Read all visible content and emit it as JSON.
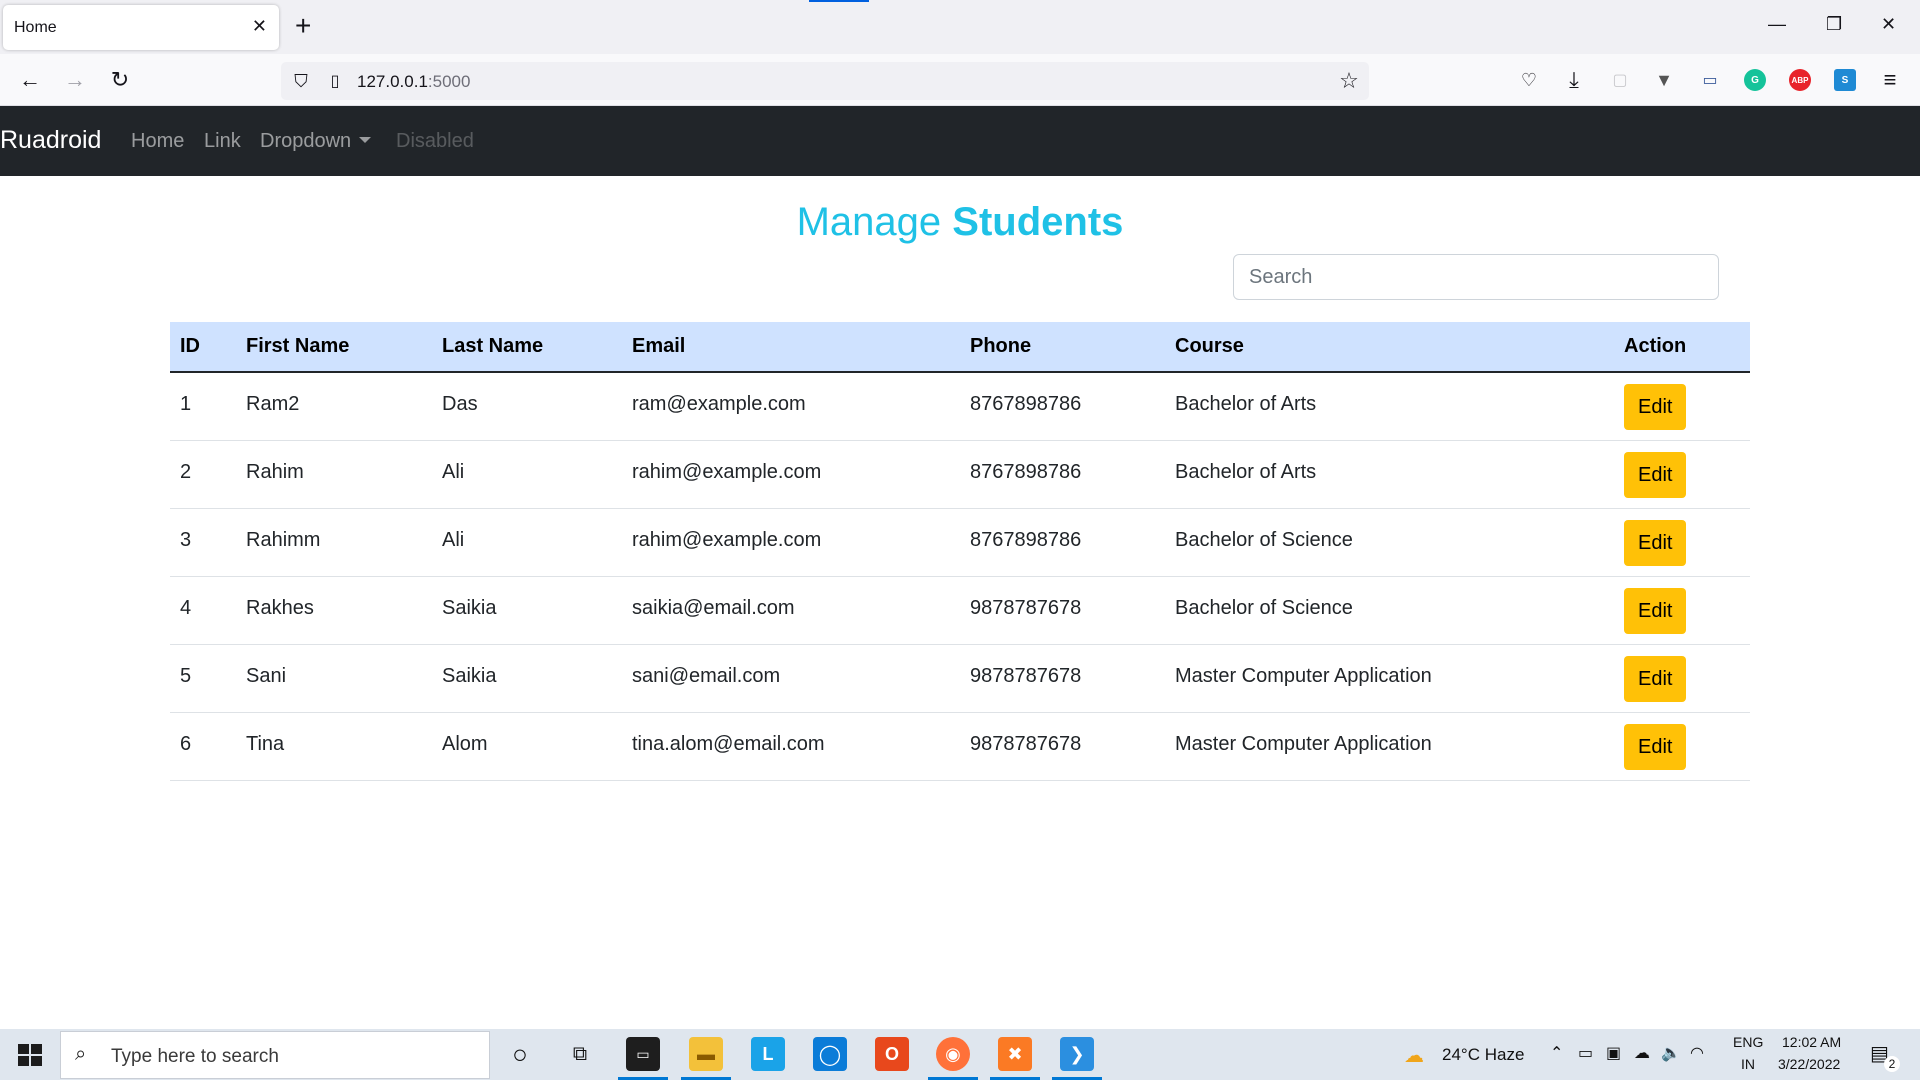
{
  "browser": {
    "tab_title": "Home",
    "tab_close": "✕",
    "new_tab": "+",
    "url_host": "127.0.0.1",
    "url_port": ":5000"
  },
  "navbar": {
    "brand": "Ruadroid",
    "links": [
      "Home",
      "Link",
      "Dropdown",
      "Disabled"
    ]
  },
  "page": {
    "title_light": "Manage ",
    "title_bold": "Students",
    "search_placeholder": "Search"
  },
  "table": {
    "headers": [
      "ID",
      "First Name",
      "Last Name",
      "Email",
      "Phone",
      "Course",
      "Action"
    ],
    "rows": [
      {
        "id": "1",
        "first": "Ram2",
        "last": "Das",
        "email": "ram@example.com",
        "phone": "8767898786",
        "course": "Bachelor of Arts",
        "action": "Edit"
      },
      {
        "id": "2",
        "first": "Rahim",
        "last": "Ali",
        "email": "rahim@example.com",
        "phone": "8767898786",
        "course": "Bachelor of Arts",
        "action": "Edit"
      },
      {
        "id": "3",
        "first": "Rahimm",
        "last": "Ali",
        "email": "rahim@example.com",
        "phone": "8767898786",
        "course": "Bachelor of Science",
        "action": "Edit"
      },
      {
        "id": "4",
        "first": "Rakhes",
        "last": "Saikia",
        "email": "saikia@email.com",
        "phone": "9878787678",
        "course": "Bachelor of Science",
        "action": "Edit"
      },
      {
        "id": "5",
        "first": "Sani",
        "last": "Saikia",
        "email": "sani@email.com",
        "phone": "9878787678",
        "course": "Master Computer Application",
        "action": "Edit"
      },
      {
        "id": "6",
        "first": "Tina",
        "last": "Alom",
        "email": "tina.alom@email.com",
        "phone": "9878787678",
        "course": "Master Computer Application",
        "action": "Edit"
      }
    ]
  },
  "taskbar": {
    "search_text": "Type here to search",
    "weather": "24°C  Haze",
    "lang_top": "ENG",
    "lang_bottom": "IN",
    "time": "12:02 AM",
    "date": "3/22/2022",
    "notif_count": "2"
  },
  "colors": {
    "title_cyan": "#1fc1e6",
    "navbar_bg": "#212529",
    "table_head_bg": "#cfe2ff",
    "edit_btn": "#ffc107"
  }
}
